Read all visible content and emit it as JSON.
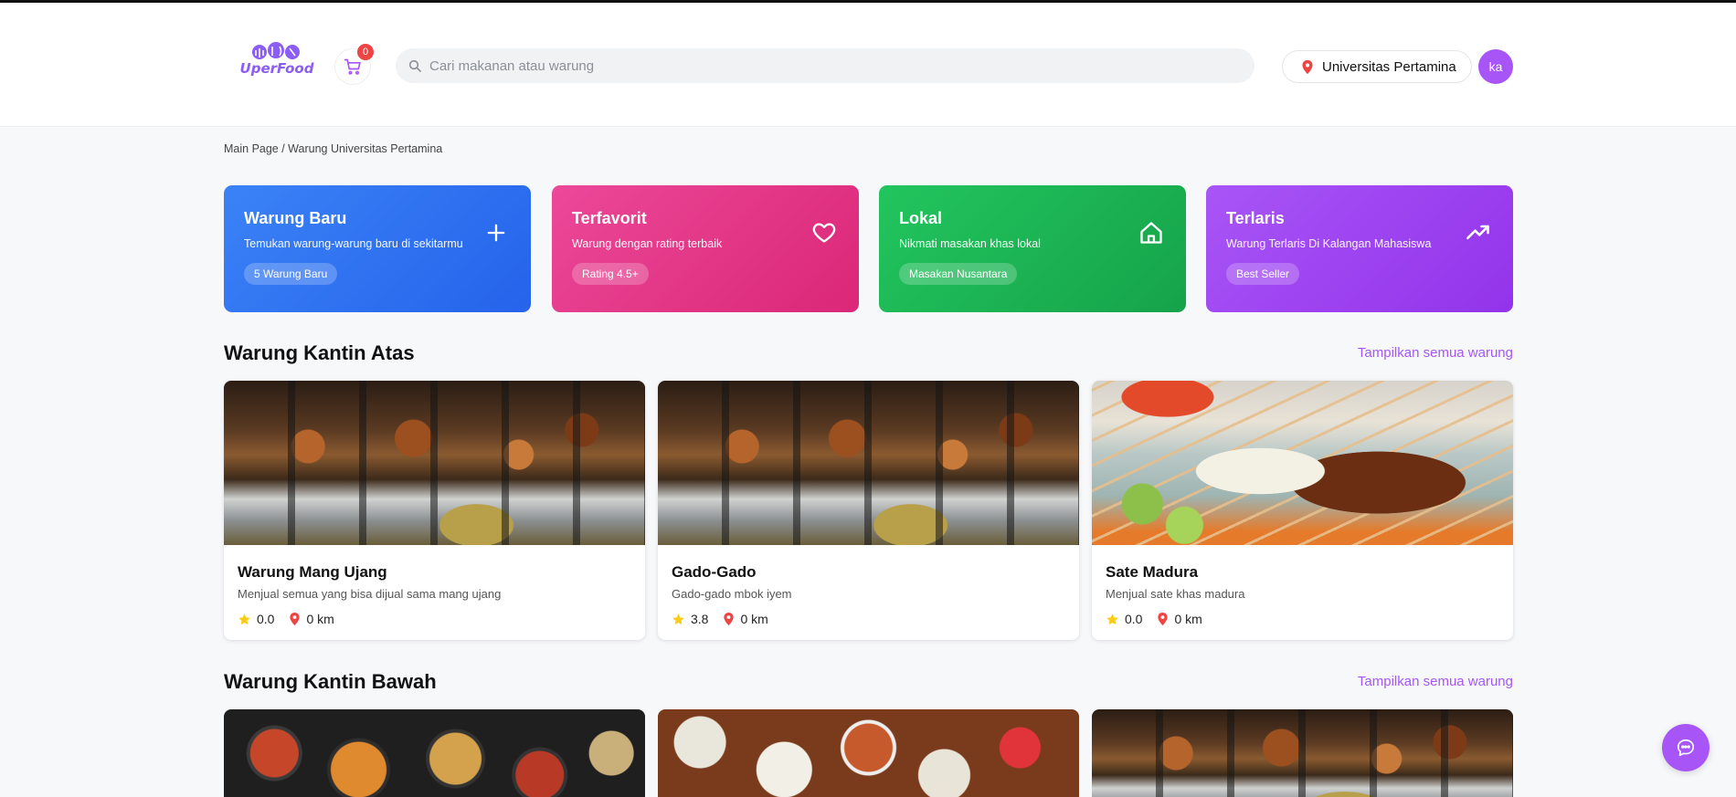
{
  "header": {
    "brand": "UperFood",
    "cart_count": "0",
    "search_placeholder": "Cari makanan atau warung",
    "location": "Universitas Pertamina",
    "avatar_initials": "ka"
  },
  "breadcrumb": "Main Page / Warung Universitas Pertamina",
  "categories": [
    {
      "title": "Warung Baru",
      "subtitle": "Temukan warung-warung baru di sekitarmu",
      "tag": "5 Warung Baru",
      "icon": "plus-icon",
      "color": "#3b82f6"
    },
    {
      "title": "Terfavorit",
      "subtitle": "Warung dengan rating terbaik",
      "tag": "Rating 4.5+",
      "icon": "heart-icon",
      "color": "#ec4899"
    },
    {
      "title": "Lokal",
      "subtitle": "Nikmati masakan khas lokal",
      "tag": "Masakan Nusantara",
      "icon": "home-icon",
      "color": "#22c55e"
    },
    {
      "title": "Terlaris",
      "subtitle": "Warung Terlaris Di Kalangan Mahasiswa",
      "tag": "Best Seller",
      "icon": "trending-up-icon",
      "color": "#a855f7"
    }
  ],
  "sections": [
    {
      "title": "Warung Kantin Atas",
      "see_all": "Tampilkan semua warung",
      "items": [
        {
          "name": "Warung Mang Ujang",
          "desc": "Menjual semua yang bisa dijual sama mang ujang",
          "rating": "0.0",
          "distance": "0 km"
        },
        {
          "name": "Gado-Gado",
          "desc": "Gado-gado mbok iyem",
          "rating": "3.8",
          "distance": "0 km"
        },
        {
          "name": "Sate Madura",
          "desc": "Menjual sate khas madura",
          "rating": "0.0",
          "distance": "0 km"
        }
      ]
    },
    {
      "title": "Warung Kantin Bawah",
      "see_all": "Tampilkan semua warung"
    }
  ],
  "colors": {
    "accent": "#a855f7",
    "star": "#facc15",
    "pin": "#ef4444"
  }
}
